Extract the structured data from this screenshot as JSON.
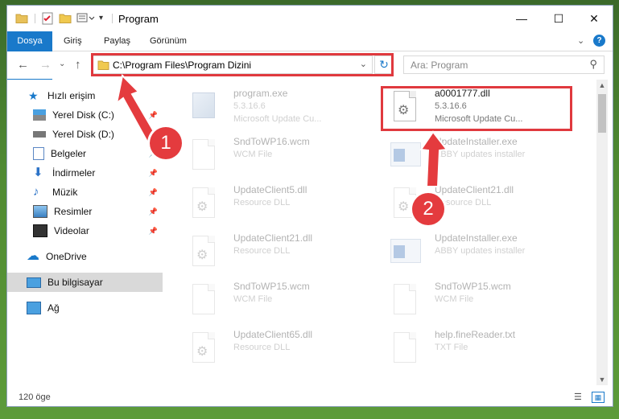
{
  "window": {
    "title": "Program"
  },
  "ribbon": {
    "tabs": [
      "Dosya",
      "Giriş",
      "Paylaş",
      "Görünüm"
    ]
  },
  "address": {
    "path": "C:\\Program Files\\Program Dizini"
  },
  "search": {
    "placeholder": "Ara: Program"
  },
  "nav": {
    "items": [
      {
        "label": "Hızlı erişim"
      },
      {
        "label": "Yerel Disk (C:)"
      },
      {
        "label": "Yerel Disk (D:)"
      },
      {
        "label": "Belgeler"
      },
      {
        "label": "İndirmeler"
      },
      {
        "label": "Müzik"
      },
      {
        "label": "Resimler"
      },
      {
        "label": "Videolar"
      },
      {
        "label": "OneDrive"
      },
      {
        "label": "Bu bilgisayar"
      },
      {
        "label": "Ağ"
      }
    ]
  },
  "files": [
    {
      "name": "program.exe",
      "line1": "5.3.16.6",
      "line2": "Microsoft Update Cu..."
    },
    {
      "name": "a0001777.dll",
      "line1": "5.3.16.6",
      "line2": "Microsoft Update Cu..."
    },
    {
      "name": "SndToWP16.wcm",
      "line1": "WCM File",
      "line2": ""
    },
    {
      "name": "UpdateInstaller.exe",
      "line1": "ABBY updates installer",
      "line2": ""
    },
    {
      "name": "UpdateClient5.dll",
      "line1": "Resource DLL",
      "line2": ""
    },
    {
      "name": "UpdateClient21.dll",
      "line1": "Resource DLL",
      "line2": ""
    },
    {
      "name": "UpdateClient21.dll",
      "line1": "Resource DLL",
      "line2": ""
    },
    {
      "name": "UpdateInstaller.exe",
      "line1": "ABBY updates installer",
      "line2": ""
    },
    {
      "name": "SndToWP15.wcm",
      "line1": "WCM File",
      "line2": ""
    },
    {
      "name": "SndToWP15.wcm",
      "line1": "WCM File",
      "line2": ""
    },
    {
      "name": "UpdateClient65.dll",
      "line1": "Resource DLL",
      "line2": ""
    },
    {
      "name": "help.fineReader.txt",
      "line1": "TXT File",
      "line2": ""
    }
  ],
  "status": {
    "count": "120 öge"
  },
  "callouts": {
    "one": "1",
    "two": "2"
  },
  "colors": {
    "accent": "#1979ca",
    "highlight": "#e0393e"
  }
}
